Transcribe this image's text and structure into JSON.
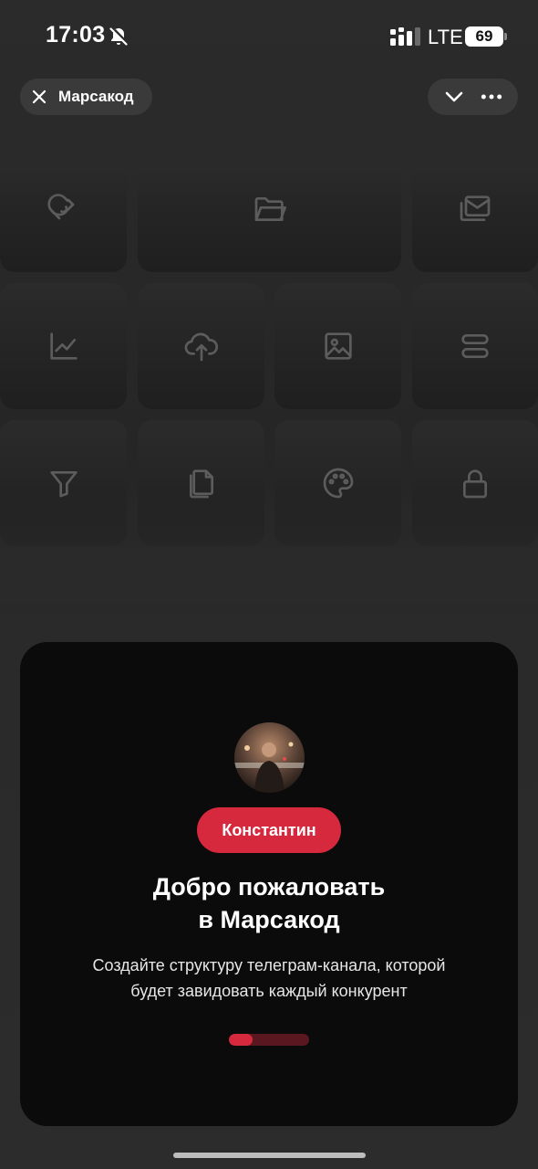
{
  "status_bar": {
    "time": "17:03",
    "network": "LTE",
    "battery": "69",
    "icons": [
      "bell-slash-icon",
      "signal-icon"
    ]
  },
  "nav": {
    "title": "Марсакод",
    "close_icon": "close-icon",
    "actions": [
      "chevron-down-icon",
      "more-horizontal-icon"
    ]
  },
  "tiles": [
    {
      "icon": "magnet-icon"
    },
    {
      "icon": "folder-open-icon"
    },
    {
      "icon": "mail-stack-icon"
    },
    {
      "icon": "line-chart-icon"
    },
    {
      "icon": "cloud-upload-icon"
    },
    {
      "icon": "image-icon"
    },
    {
      "icon": "layout-rows-icon"
    },
    {
      "icon": "filter-icon"
    },
    {
      "icon": "copy-document-icon"
    },
    {
      "icon": "palette-icon"
    },
    {
      "icon": "lock-icon"
    }
  ],
  "welcome": {
    "name": "Константин",
    "title_line1": "Добро пожаловать",
    "title_line2": "в Марсакод",
    "desc_line1": "Создайте структуру телеграм-канала, которой",
    "desc_line2": "будет завидовать каждый конкурент",
    "progress": 0.3
  },
  "colors": {
    "accent": "#d6293e",
    "accent_dim": "#5b1720",
    "card_bg": "#0b0b0b",
    "page_bg": "#2a2a2a",
    "pill_bg": "#3a3a3a"
  }
}
